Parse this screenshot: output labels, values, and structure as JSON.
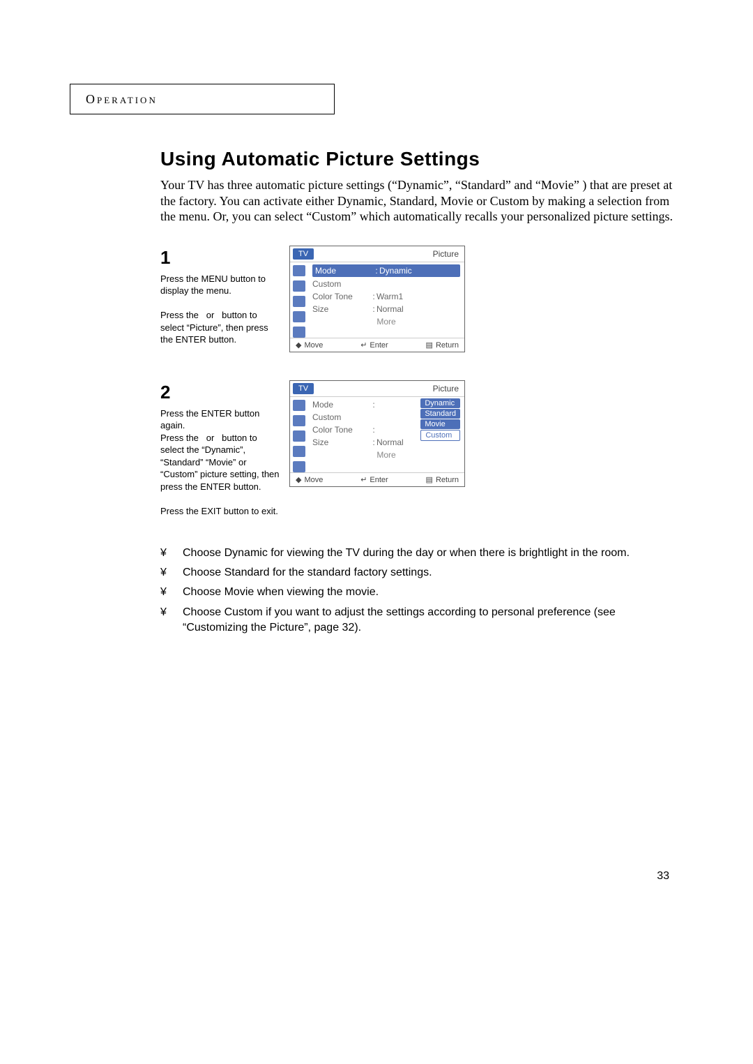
{
  "section_label": "Operation",
  "title": "Using Automatic Picture Settings",
  "intro": "Your TV has three automatic picture settings (“Dynamic”, “Standard” and “Movie” ) that are preset at the factory.  You can activate either Dynamic, Standard, Movie or Custom by making a selection from the menu. Or, you can select “Custom” which automatically recalls your personalized picture settings.",
  "steps": {
    "s1": {
      "num": "1",
      "text": "Press the MENU button to display the menu.\n\nPress the   or   button to select “Picture”, then press the ENTER button."
    },
    "s2": {
      "num": "2",
      "text": "Press the ENTER button again.\nPress the   or   button to select the “Dynamic”, “Standard” “Movie” or “Custom” picture setting, then press the ENTER button.\n\nPress the EXIT button to exit."
    }
  },
  "osd": {
    "tv": "TV",
    "title": "Picture",
    "rows": {
      "mode": {
        "label": "Mode",
        "value": "Dynamic"
      },
      "custom": {
        "label": "Custom"
      },
      "colortone": {
        "label": "Color Tone",
        "value": "Warm1"
      },
      "size": {
        "label": "Size",
        "value": "Normal"
      },
      "more": {
        "label": "More"
      }
    },
    "dropdown": [
      "Dynamic",
      "Standard",
      "Movie",
      "Custom"
    ],
    "dropdown_below": "Normal",
    "footer": {
      "move": "Move",
      "enter": "Enter",
      "return": "Return"
    }
  },
  "bullets": [
    "Choose Dynamic for viewing the TV during the day or when there is brightlight in the room.",
    "Choose Standard for the standard factory settings.",
    "Choose Movie when viewing the movie.",
    "Choose Custom if you want to adjust the settings according to personal preference (see “Customizing the Picture”, page 32)."
  ],
  "bullet_sym": "¥",
  "page_number": "33"
}
